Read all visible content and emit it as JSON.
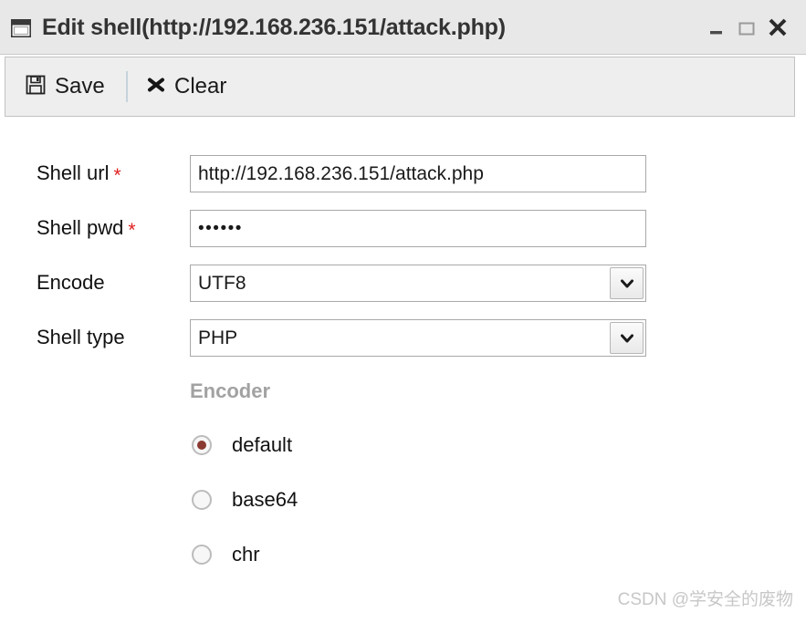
{
  "window": {
    "title": "Edit shell(http://192.168.236.151/attack.php)",
    "icon": "window-icon",
    "controls": {
      "minimize": "minimize-icon",
      "maximize": "maximize-icon",
      "close": "close-icon"
    }
  },
  "toolbar": {
    "save_label": "Save",
    "save_icon": "floppy-disk-icon",
    "clear_label": "Clear",
    "clear_icon": "x-icon"
  },
  "form": {
    "rows": [
      {
        "label": "Shell url",
        "required": "*",
        "type": "text",
        "value": "http://192.168.236.151/attack.php"
      },
      {
        "label": "Shell pwd",
        "required": "*",
        "type": "password",
        "value": "••••••"
      },
      {
        "label": "Encode",
        "required": "",
        "type": "select",
        "value": "UTF8"
      },
      {
        "label": "Shell type",
        "required": "",
        "type": "select",
        "value": "PHP"
      }
    ]
  },
  "encoder": {
    "title": "Encoder",
    "options": [
      {
        "label": "default",
        "selected": true
      },
      {
        "label": "base64",
        "selected": false
      },
      {
        "label": "chr",
        "selected": false
      }
    ]
  },
  "watermark": {
    "text": "CSDN @学安全的废物"
  },
  "colors": {
    "titlebar_bg": "#e8e8e8",
    "toolbar_bg": "#eeeeee",
    "required_star": "#e02020",
    "encoder_heading": "#a2a2a2",
    "radio_selected": "#8a3a31",
    "watermark": "#c7c7c7"
  }
}
